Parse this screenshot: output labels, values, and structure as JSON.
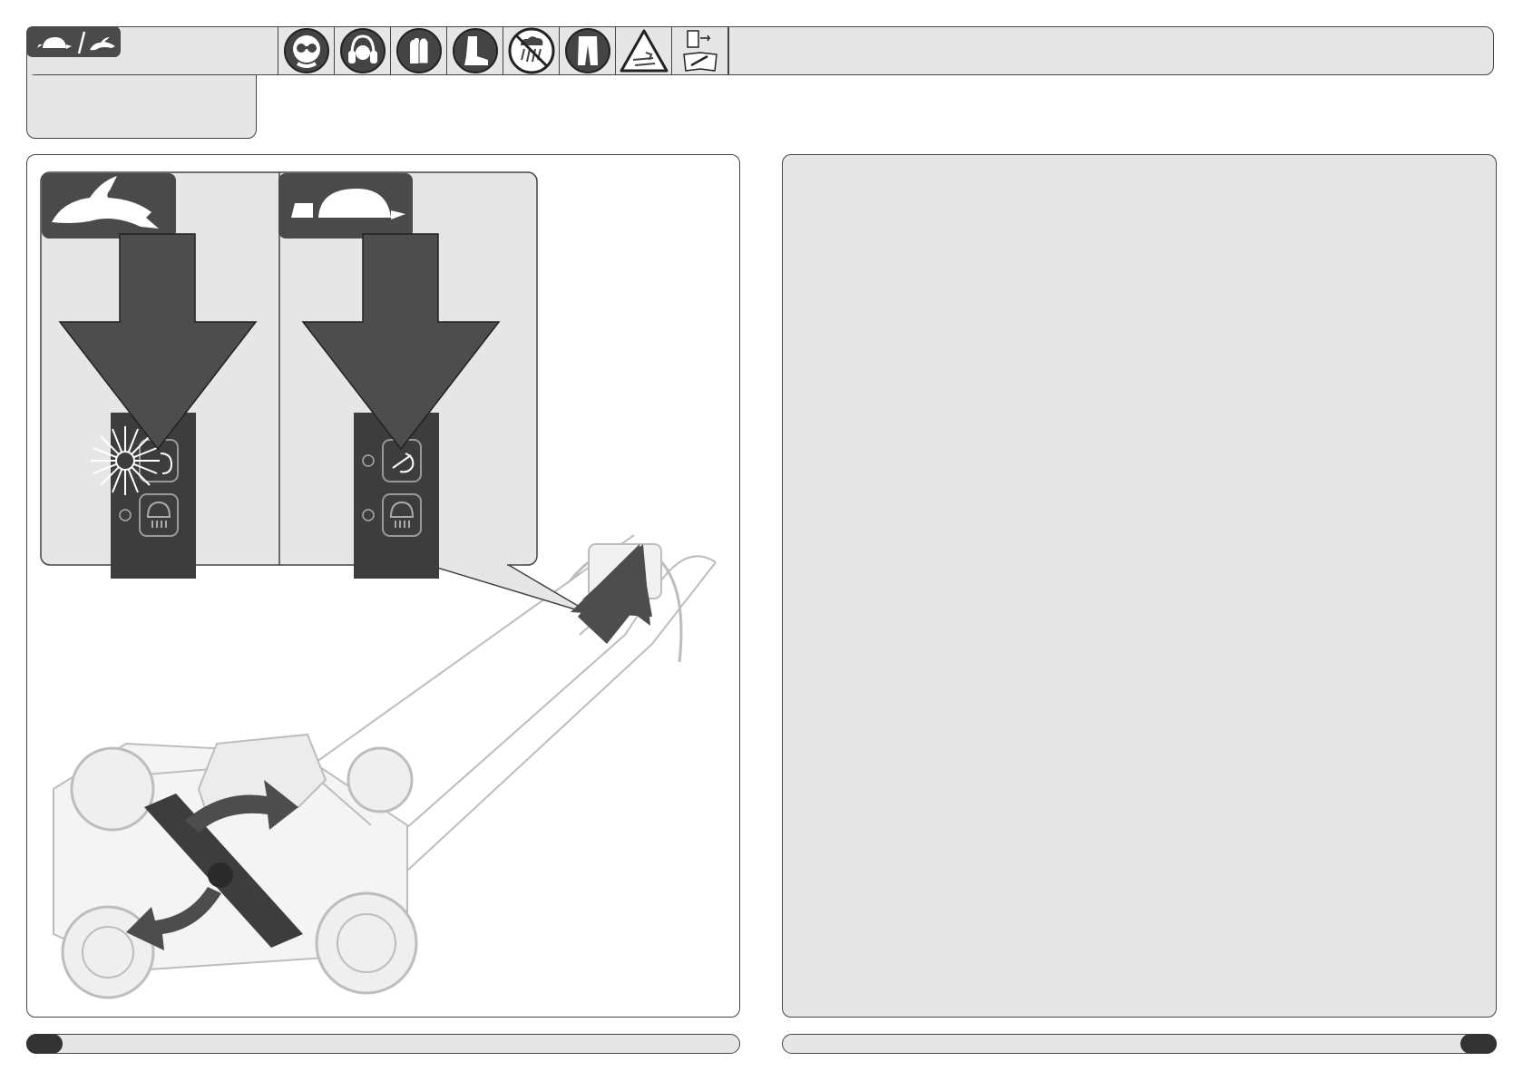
{
  "header": {
    "mode_badge_icon": "turtle-slash-rabbit-icon",
    "safety_icons": [
      "safety-glasses-icon",
      "ear-protection-icon",
      "gloves-icon",
      "safety-boots-icon",
      "no-rain-icon",
      "long-trousers-icon",
      "blade-hazard-warning-icon",
      "remove-battery-read-manual-icon"
    ]
  },
  "figure": {
    "modes": [
      {
        "icon": "rabbit-icon",
        "meaning": "fast",
        "indicator": "lit"
      },
      {
        "icon": "turtle-icon",
        "meaning": "slow",
        "indicator": "off"
      }
    ],
    "device": "lawn-mower",
    "callout": "control-panel-arrow"
  },
  "colors": {
    "panel_gray": "#e6e6e6",
    "arrow_dark": "#4d4d4d",
    "outline": "#444444",
    "pill_dark": "#333333"
  }
}
